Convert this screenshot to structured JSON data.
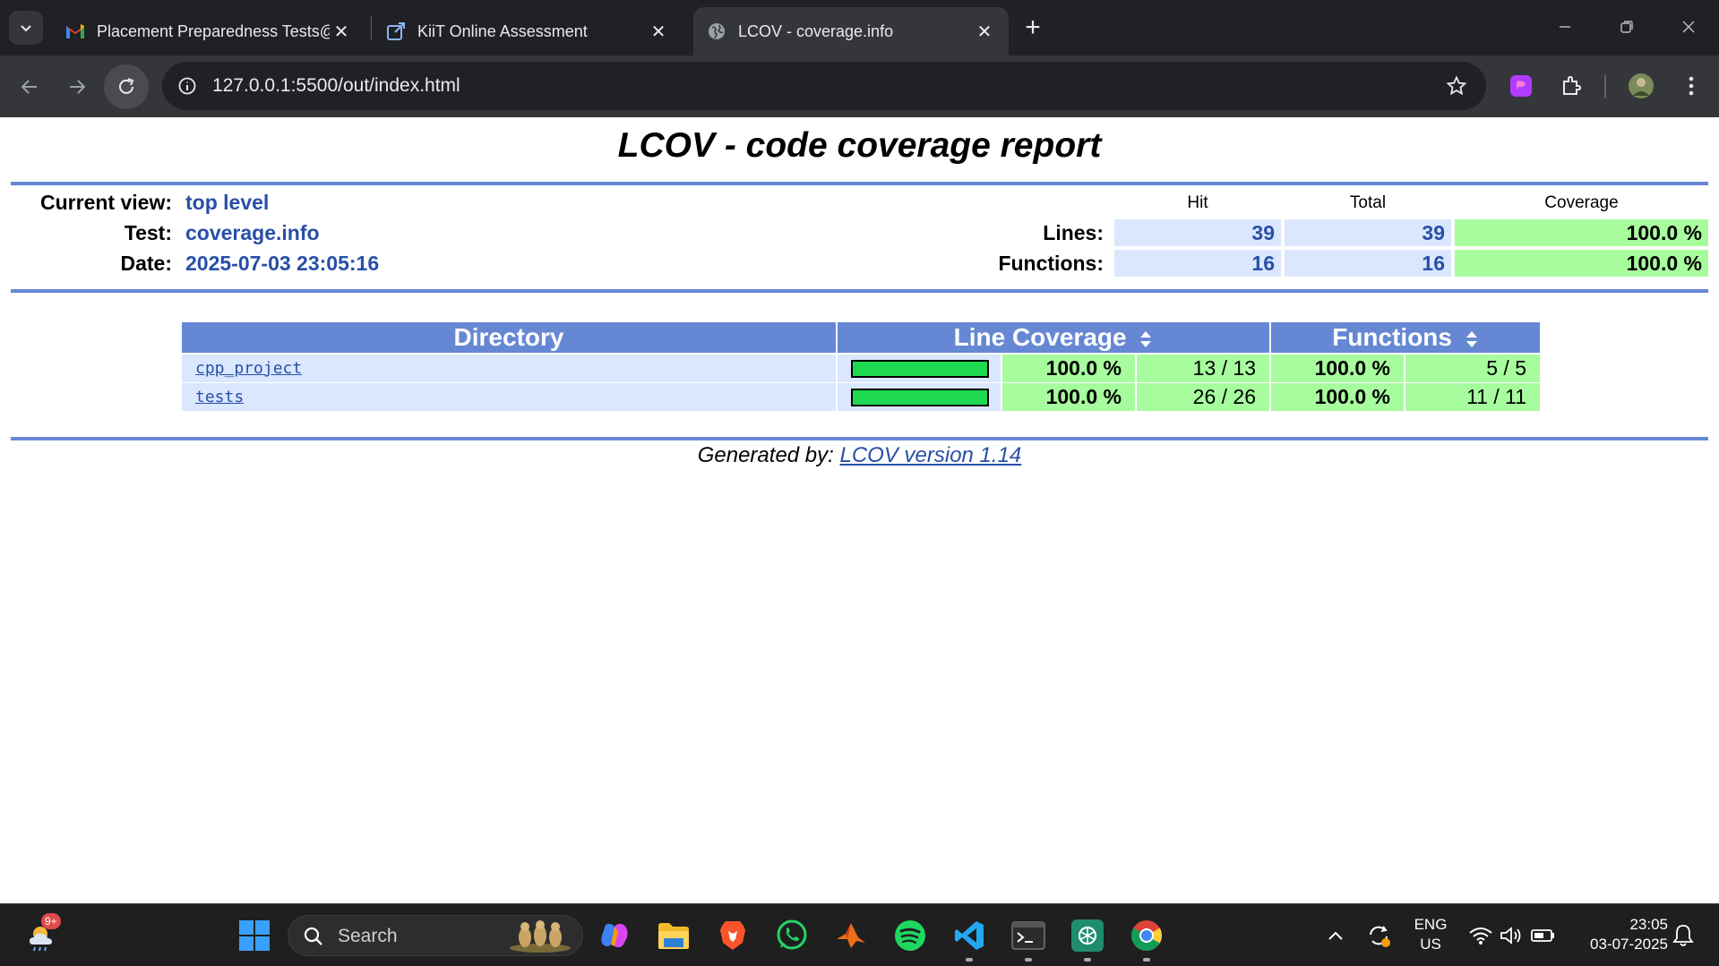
{
  "browser": {
    "tabs": [
      {
        "title": "Placement Preparedness Tests@",
        "icon": "gmail-icon",
        "active": false
      },
      {
        "title": "KiiT Online Assessment",
        "icon": "external-link-icon",
        "active": false
      },
      {
        "title": "LCOV - coverage.info",
        "icon": "globe-icon",
        "active": true
      }
    ],
    "url": "127.0.0.1:5500/out/index.html"
  },
  "report": {
    "title": "LCOV - code coverage report",
    "header": {
      "current_view_label": "Current view:",
      "current_view_value": "top level",
      "test_label": "Test:",
      "test_value": "coverage.info",
      "date_label": "Date:",
      "date_value": "2025-07-03 23:05:16",
      "col_hit": "Hit",
      "col_total": "Total",
      "col_coverage": "Coverage",
      "lines_label": "Lines:",
      "lines_hit": "39",
      "lines_total": "39",
      "lines_coverage": "100.0 %",
      "functions_label": "Functions:",
      "functions_hit": "16",
      "functions_total": "16",
      "functions_coverage": "100.0 %"
    },
    "table": {
      "col_directory": "Directory",
      "col_line_coverage": "Line Coverage",
      "col_functions": "Functions",
      "rows": [
        {
          "name": "cpp_project",
          "line_bar": 1.0,
          "line_pct": "100.0 %",
          "line_count": "13 / 13",
          "func_pct": "100.0 %",
          "func_count": "5 / 5"
        },
        {
          "name": "tests",
          "line_bar": 1.0,
          "line_pct": "100.0 %",
          "line_count": "26 / 26",
          "func_pct": "100.0 %",
          "func_count": "11 / 11"
        }
      ]
    },
    "footer": {
      "prefix": "Generated by:",
      "link": "LCOV version 1.14"
    }
  },
  "taskbar": {
    "weather_badge": "9+",
    "search_label": "Search",
    "lang_top": "ENG",
    "lang_bottom": "US",
    "time": "23:05",
    "date": "03-07-2025"
  },
  "colors": {
    "rule": "#6688d4",
    "hit_bg": "#dae7fe",
    "coverage_bg": "#a7fc9d",
    "bar_fill": "#1dd850",
    "link": "#284fa8"
  }
}
